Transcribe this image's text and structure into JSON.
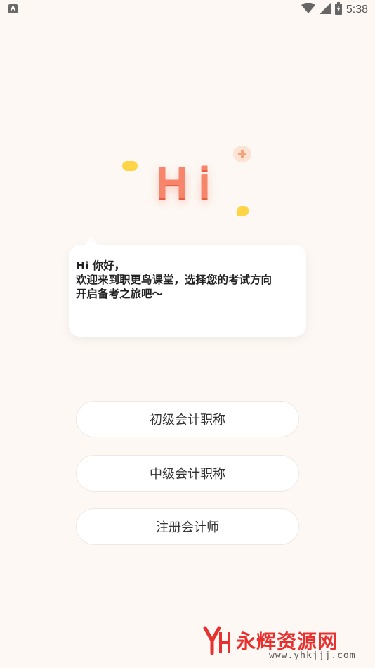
{
  "status_bar": {
    "notification_icon": "A",
    "time": "5:38",
    "icons": [
      "wifi-icon",
      "signal-icon",
      "battery-icon"
    ]
  },
  "hero": {
    "greeting_art": "Hi"
  },
  "speech_bubble": {
    "text": "Hi 你好，\n欢迎来到职更鸟课堂，选择您的考试方向\n开启备考之旅吧～"
  },
  "options": [
    {
      "label": "初级会计职称"
    },
    {
      "label": "中级会计职称"
    },
    {
      "label": "注册会计师"
    }
  ],
  "watermark": {
    "title": "永辉资源网",
    "url": "www.yhkjjj.com"
  },
  "colors": {
    "background": "#fdf8f4",
    "accent": "#f7856b",
    "watermark": "#e8312f"
  }
}
